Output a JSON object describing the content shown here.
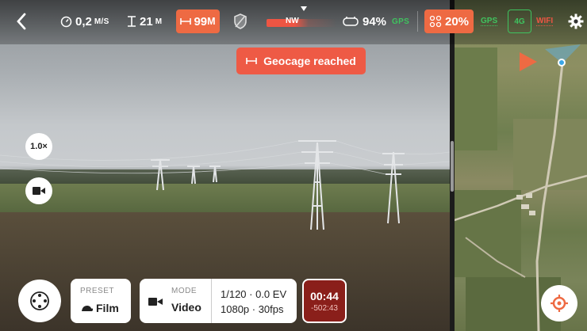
{
  "topbar": {
    "speed": "0,2",
    "speed_unit": "M/S",
    "altitude": "21",
    "altitude_unit": "M",
    "distance": "99",
    "distance_unit": "M",
    "compass_label": "NW",
    "controller_battery": "94%",
    "controller_gps": "GPS",
    "drone_battery": "20%",
    "drone_gps": "GPS",
    "network_4g": "4G",
    "network_wifi": "WIFI"
  },
  "toast": {
    "text": "Geocage reached"
  },
  "camera": {
    "zoom": "1.0×"
  },
  "bottom": {
    "preset_label": "PRESET",
    "preset_value": "Film",
    "mode_label": "MODE",
    "mode_value": "Video",
    "exposure": "1/120 · 0.0 EV",
    "resolution": "1080p · 30fps",
    "record_time": "00:44",
    "remaining_time": "-502:43"
  },
  "colors": {
    "accent_orange": "#ee6a43",
    "alert_red": "#ee5a45",
    "record_red": "#8a1f1a",
    "gps_green": "#3fc35f",
    "home_blue": "#3aa6e8"
  },
  "icons": {
    "back": "chevron-left-icon",
    "speed": "speedometer-icon",
    "altitude": "altitude-icon",
    "distance": "distance-icon",
    "obstacle": "shield-slash-icon",
    "controller": "controller-icon",
    "drone_battery": "drone-battery-icon",
    "settings": "gear-icon",
    "camera_settings": "aperture-icon",
    "video": "video-camera-icon",
    "center_map": "target-icon"
  }
}
